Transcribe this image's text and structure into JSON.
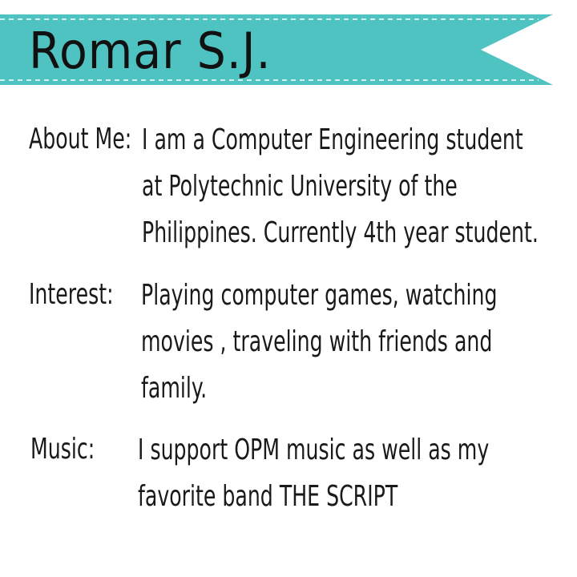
{
  "banner": {
    "title": "Romar S.J.",
    "color": "#4fc3c1",
    "stitch_color": "#ffffff"
  },
  "sections": [
    {
      "label": "About Me:",
      "lines": [
        "I am a Computer Engineering student",
        "at Polytechnic University of the",
        "Philippines. Currently 4th year student."
      ]
    },
    {
      "label": "Interest:",
      "lines": [
        "Playing computer games, watching",
        "movies , traveling with friends and",
        "family."
      ]
    },
    {
      "label": "Music:",
      "lines": [
        "I support OPM music as well as my",
        "favorite band THE SCRIPT"
      ]
    }
  ]
}
